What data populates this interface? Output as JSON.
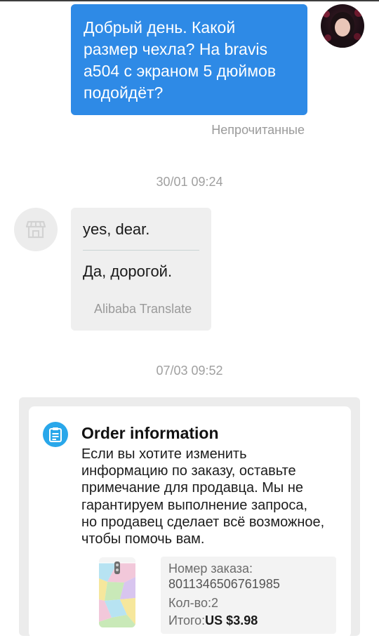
{
  "outgoing_message": {
    "line1": "Добрый день. Какой",
    "line2": "размер чехла? На bravis",
    "line3": "a504 с экраном  5 дюймов",
    "line4": "подойдёт?",
    "status": "Непрочитанные"
  },
  "timestamp_1": "30/01 09:24",
  "incoming_message": {
    "original": "yes, dear.",
    "translation": "Да, дорогой.",
    "translator": "Alibaba Translate"
  },
  "timestamp_2": "07/03 09:52",
  "order_card": {
    "title": "Order information",
    "desc_lines": [
      "Если вы хотите изменить",
      "информацию по заказу, оставьте",
      "примечание для продавца. Мы не",
      "гарантируем выполнение запроса,",
      "но продавец сделает всё возможное,",
      "чтобы помочь вам."
    ],
    "order_number_label": "Номер заказа:",
    "order_number": "8011346506761985",
    "quantity_text": "Кол-во:2",
    "total_label": "Итого:",
    "total_value": "US $3.98"
  },
  "colors": {
    "outgoing_bubble": "#2e8ae6",
    "incoming_bubble": "#efefef",
    "order_icon": "#29a7ea"
  },
  "icons": {
    "user_avatar": "user-avatar",
    "store_avatar": "store-icon",
    "order_icon": "clipboard-icon"
  }
}
